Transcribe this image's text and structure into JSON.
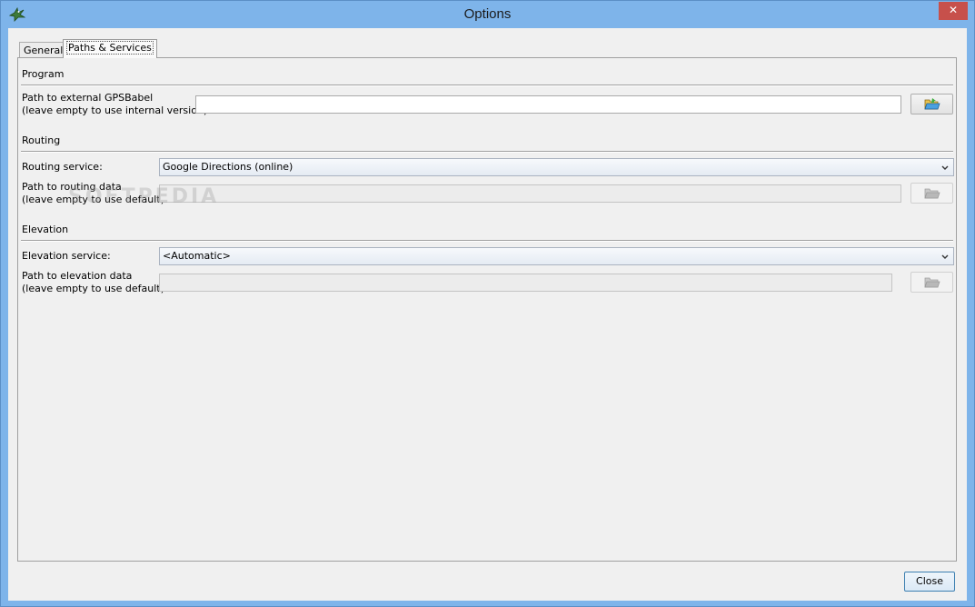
{
  "window": {
    "title": "Options",
    "close_glyph": "✕"
  },
  "tabs": [
    {
      "label": "General"
    },
    {
      "label": "Paths & Services",
      "selected": true
    }
  ],
  "program": {
    "section": "Program",
    "gpsbabel_label_1": "Path to external GPSBabel",
    "gpsbabel_label_2": "(leave empty to use internal version):",
    "gpsbabel_value": ""
  },
  "routing": {
    "section": "Routing",
    "service_label": "Routing service:",
    "service_value": "Google Directions (online)",
    "data_label_1": "Path to routing data",
    "data_label_2": "(leave empty to use default):",
    "data_value": ""
  },
  "elevation": {
    "section": "Elevation",
    "service_label": "Elevation service:",
    "service_value": "<Automatic>",
    "data_label_1": "Path to elevation data",
    "data_label_2": "(leave empty to use default):",
    "data_value": ""
  },
  "watermark": "SOFTPEDIA",
  "footer": {
    "close_label": "Close"
  },
  "icons": {
    "app": "bird-icon",
    "browse": "folder-open-icon",
    "dropdown": "chevron-down-icon"
  }
}
